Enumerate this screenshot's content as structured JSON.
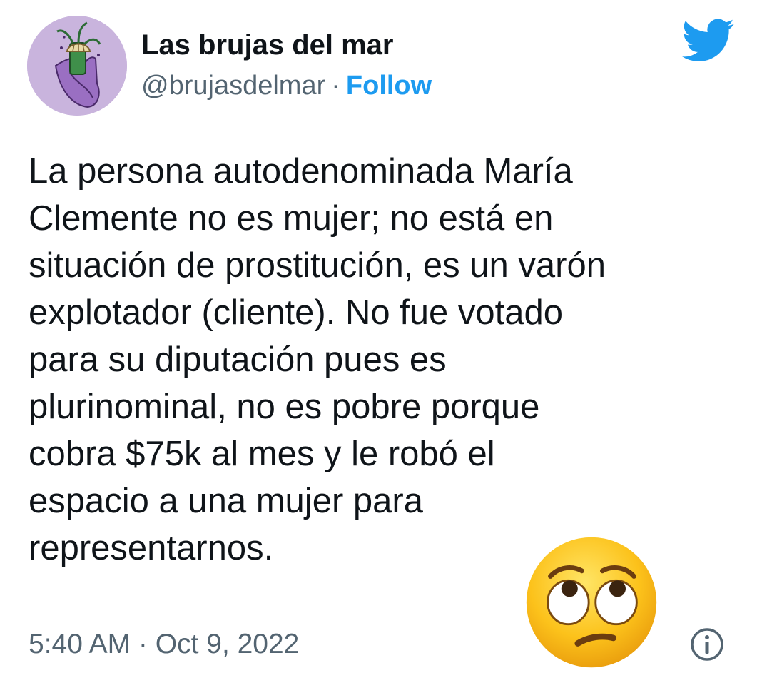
{
  "author": {
    "display_name": "Las brujas del mar",
    "handle": "@brujasdelmar",
    "separator": "·",
    "follow_label": "Follow",
    "avatar_icon": "witch-hands-illustration",
    "follow_color": "#1d9bf0"
  },
  "brand": {
    "icon": "twitter-bird-icon",
    "color": "#1d9bf0"
  },
  "tweet": {
    "lines": [
      "La persona autodenominada María",
      "Clemente no es mujer; no está en",
      "situación de prostitución, es un varón",
      "explotador (cliente). No fue votado",
      "para su diputación pues es",
      "plurinominal, no es pobre porque",
      "cobra $75k al mes y le robó el",
      "espacio a una mujer para",
      "representarnos."
    ],
    "emoji": "face-with-rolling-eyes",
    "timestamp": "5:40 AM · Oct 9, 2022",
    "info_icon": "info-icon"
  }
}
